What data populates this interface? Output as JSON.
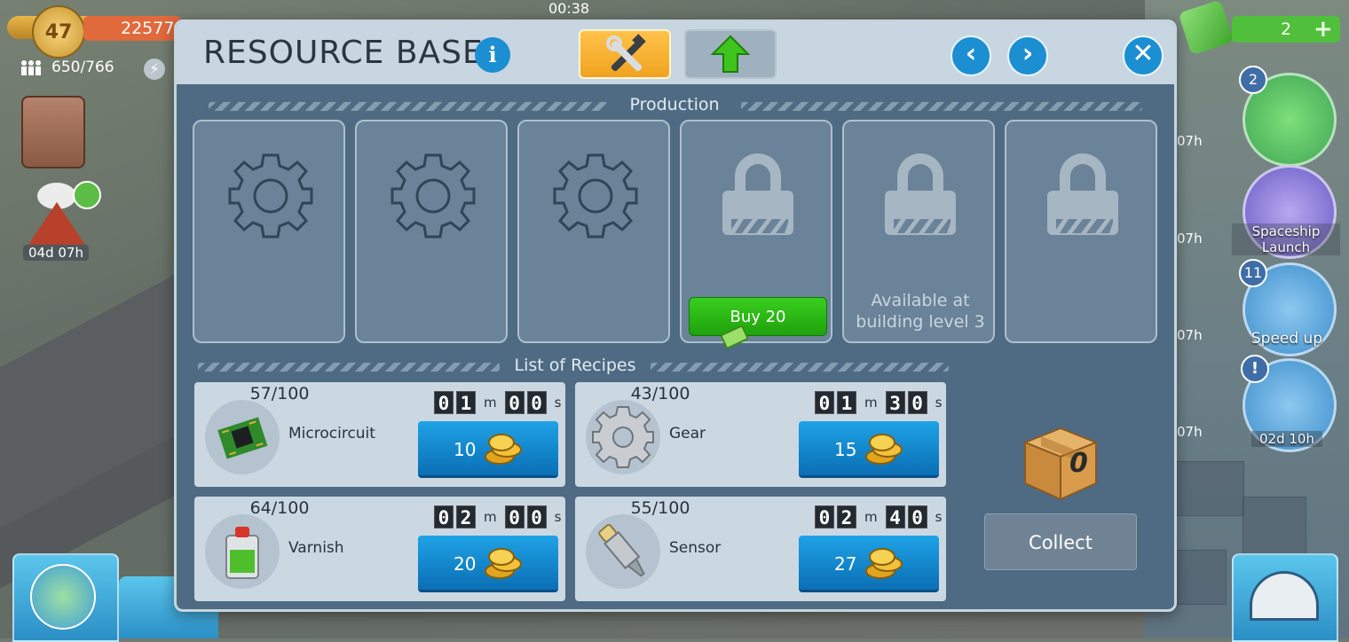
{
  "hud": {
    "level": "47",
    "xp": "22577",
    "population": "650/766",
    "clock": "00:38",
    "volcano_timer": "04d 07h",
    "cash": "2",
    "cash_plus": "+",
    "side_timers": [
      "07h",
      "07h",
      "07h",
      "07h"
    ],
    "radar_badges": [
      "2",
      "11"
    ],
    "radar_labels": {
      "spaceship": "Spaceship Launch",
      "speed_up": "Speed up",
      "gauge_timer": "02d 10h"
    }
  },
  "dialog": {
    "title": "RESOURCE BASE",
    "info_label": "i",
    "tabs": [
      {
        "name": "production",
        "icon": "tools-icon",
        "active": true
      },
      {
        "name": "upgrade",
        "icon": "upgrade-arrow-icon",
        "active": false
      }
    ],
    "production_label": "Production",
    "slots": [
      {
        "state": "empty",
        "icon": "gear-icon"
      },
      {
        "state": "empty",
        "icon": "gear-icon"
      },
      {
        "state": "empty",
        "icon": "gear-icon"
      },
      {
        "state": "locked",
        "icon": "lock-icon",
        "buy_label": "Buy 20"
      },
      {
        "state": "locked",
        "icon": "lock-icon",
        "note": "Available at building level 3"
      },
      {
        "state": "locked",
        "icon": "lock-icon"
      }
    ],
    "recipes_label": "List of Recipes",
    "recipes": [
      {
        "name": "Microcircuit",
        "count": "57/100",
        "time": {
          "m": "01",
          "s": "00"
        },
        "price": "10",
        "icon": "microcircuit-icon"
      },
      {
        "name": "Gear",
        "count": "43/100",
        "time": {
          "m": "01",
          "s": "30"
        },
        "price": "15",
        "icon": "gear-icon"
      },
      {
        "name": "Varnish",
        "count": "64/100",
        "time": {
          "m": "02",
          "s": "00"
        },
        "price": "20",
        "icon": "varnish-can-icon"
      },
      {
        "name": "Sensor",
        "count": "55/100",
        "time": {
          "m": "02",
          "s": "40"
        },
        "price": "27",
        "icon": "sensor-icon"
      }
    ],
    "time_units": {
      "m": "m",
      "s": "s"
    },
    "storage_count": "0",
    "collect_label": "Collect"
  },
  "colors": {
    "dialog_bg": "#4e6b83",
    "header_bg": "#c8d6e1",
    "accent_blue": "#1b8fd1",
    "buy_green": "#2fb714",
    "tab_active": "#f7b02f"
  }
}
